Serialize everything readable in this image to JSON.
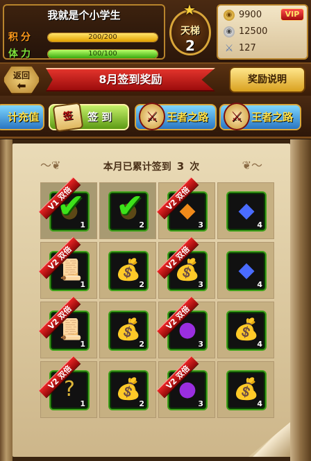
{
  "player": {
    "name": "我就是个小学生",
    "score_label": "积分",
    "score_value": "200/200",
    "score_fill": 1.0,
    "stamina_label": "体力",
    "stamina_value": "100/100",
    "stamina_fill": 1.0
  },
  "ladder": {
    "title": "天梯",
    "level": "2"
  },
  "currency": {
    "gold": "9900",
    "silver": "12500",
    "energy": "127",
    "vip_label": "VIP"
  },
  "banner": {
    "back_label": "返回",
    "title": "8月签到奖励",
    "rules_label": "奖励说明"
  },
  "tabs": {
    "recharge": "计充值",
    "signin": "签 到",
    "road1": "王者之路",
    "road2": "王者之路",
    "calendar_glyph": "签"
  },
  "counter": {
    "prefix": "本月已累计签到",
    "count": "3",
    "suffix": "次"
  },
  "icons": {
    "flourish_left": "〜❦",
    "flourish_right": "❦〜"
  },
  "grid": [
    {
      "item": "check",
      "count": "1",
      "tag": "V1 双倍",
      "signed": true
    },
    {
      "item": "check",
      "count": "2",
      "tag": "",
      "signed": true
    },
    {
      "item": "amber-crystal",
      "count": "3",
      "tag": "V2 双倍",
      "signed": false
    },
    {
      "item": "blue-crystal",
      "count": "4",
      "tag": "",
      "signed": false
    },
    {
      "item": "scroll",
      "count": "1",
      "tag": "V2 双倍",
      "signed": false
    },
    {
      "item": "silver-sack",
      "count": "2",
      "tag": "",
      "signed": false
    },
    {
      "item": "gold-sack",
      "count": "3",
      "tag": "V2 双倍",
      "signed": false
    },
    {
      "item": "blue-crystal",
      "count": "4",
      "tag": "",
      "signed": false
    },
    {
      "item": "scroll",
      "count": "1",
      "tag": "V2 双倍",
      "signed": false
    },
    {
      "item": "silver-sack",
      "count": "2",
      "tag": "",
      "signed": false
    },
    {
      "item": "purple-orb",
      "count": "3",
      "tag": "V2 双倍",
      "signed": false
    },
    {
      "item": "gold-sack",
      "count": "4",
      "tag": "",
      "signed": false
    },
    {
      "item": "mystery-orb",
      "count": "1",
      "tag": "V2 双倍",
      "signed": false
    },
    {
      "item": "gold-sack",
      "count": "2",
      "tag": "",
      "signed": false
    },
    {
      "item": "purple-orb",
      "count": "3",
      "tag": "V2 双倍",
      "signed": false
    },
    {
      "item": "silver-sack",
      "count": "4",
      "tag": "",
      "signed": false
    }
  ],
  "item_glyphs": {
    "check": "✔",
    "amber-crystal": "◆",
    "blue-crystal": "◆",
    "scroll": "📜",
    "silver-sack": "💰",
    "gold-sack": "💰",
    "purple-orb": "●",
    "mystery-orb": "?"
  },
  "item_colors": {
    "amber-crystal": "#f08a1a",
    "blue-crystal": "#4a6cff",
    "scroll": "#c9a26a",
    "silver-sack": "#c9c9c9",
    "gold-sack": "#e8b020",
    "purple-orb": "#9a2ee0",
    "mystery-orb": "#e0b83a"
  }
}
